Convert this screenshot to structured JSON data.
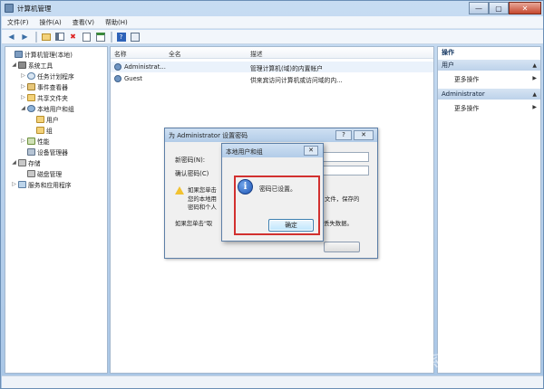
{
  "window": {
    "title": "计算机管理",
    "controls": {
      "minimize": "—",
      "maximize": "▢",
      "close": "✕"
    }
  },
  "menu": [
    "文件(F)",
    "操作(A)",
    "查看(V)",
    "帮助(H)"
  ],
  "toolbar": {
    "icons": [
      "back-icon",
      "forward-icon",
      "up-folder-icon",
      "show-tree-icon",
      "delete-icon",
      "properties-icon",
      "refresh-icon",
      "help-icon",
      "console-icon"
    ]
  },
  "tree": [
    {
      "label": "计算机管理(本地)",
      "depth": 0,
      "expander": "",
      "icon": "computer-icon"
    },
    {
      "label": "系统工具",
      "depth": 1,
      "expander": "◢",
      "icon": "tools-icon"
    },
    {
      "label": "任务计划程序",
      "depth": 2,
      "expander": "▷",
      "icon": "clock-icon"
    },
    {
      "label": "事件查看器",
      "depth": 2,
      "expander": "▷",
      "icon": "event-log-icon"
    },
    {
      "label": "共享文件夹",
      "depth": 2,
      "expander": "▷",
      "icon": "shared-folder-icon"
    },
    {
      "label": "本地用户和组",
      "depth": 2,
      "expander": "◢",
      "icon": "users-icon"
    },
    {
      "label": "用户",
      "depth": 3,
      "expander": "",
      "icon": "folder-icon"
    },
    {
      "label": "组",
      "depth": 3,
      "expander": "",
      "icon": "folder-icon"
    },
    {
      "label": "性能",
      "depth": 2,
      "expander": "▷",
      "icon": "performance-icon"
    },
    {
      "label": "设备管理器",
      "depth": 2,
      "expander": "",
      "icon": "device-manager-icon"
    },
    {
      "label": "存储",
      "depth": 1,
      "expander": "◢",
      "icon": "storage-icon"
    },
    {
      "label": "磁盘管理",
      "depth": 2,
      "expander": "",
      "icon": "disk-icon"
    },
    {
      "label": "服务和应用程序",
      "depth": 1,
      "expander": "▷",
      "icon": "services-icon"
    }
  ],
  "list": {
    "columns": [
      "名称",
      "全名",
      "描述"
    ],
    "rows": [
      {
        "name": "Administrat...",
        "fullname": "",
        "description": "管理计算机(域)的内置帐户",
        "icon": "user-icon"
      },
      {
        "name": "Guest",
        "fullname": "",
        "description": "供来宾访问计算机或访问域的内...",
        "icon": "user-icon"
      }
    ]
  },
  "actions": {
    "header": "操作",
    "sections": [
      {
        "title": "用户",
        "items": [
          "更多操作"
        ]
      },
      {
        "title": "Administrator",
        "items": [
          "更多操作"
        ]
      }
    ]
  },
  "password_dialog": {
    "title": "为 Administrator 设置密码",
    "help": "?",
    "close": "✕",
    "new_password_label": "新密码(N):",
    "confirm_password_label": "确认密码(C)",
    "warning_lines": [
      "如果您单击",
      "此帐户将",
      "立即丢失对",
      "您的本地用",
      "文件，保存的",
      "密码和个人"
    ],
    "footer_left": "如果您单击\"取",
    "footer_right": "丢失数据。"
  },
  "message_box": {
    "title": "本地用户和组",
    "close": "✕",
    "message": "密码已设置。",
    "ok_label": "确定",
    "icon": "info-icon"
  },
  "watermark": "系统之家"
}
